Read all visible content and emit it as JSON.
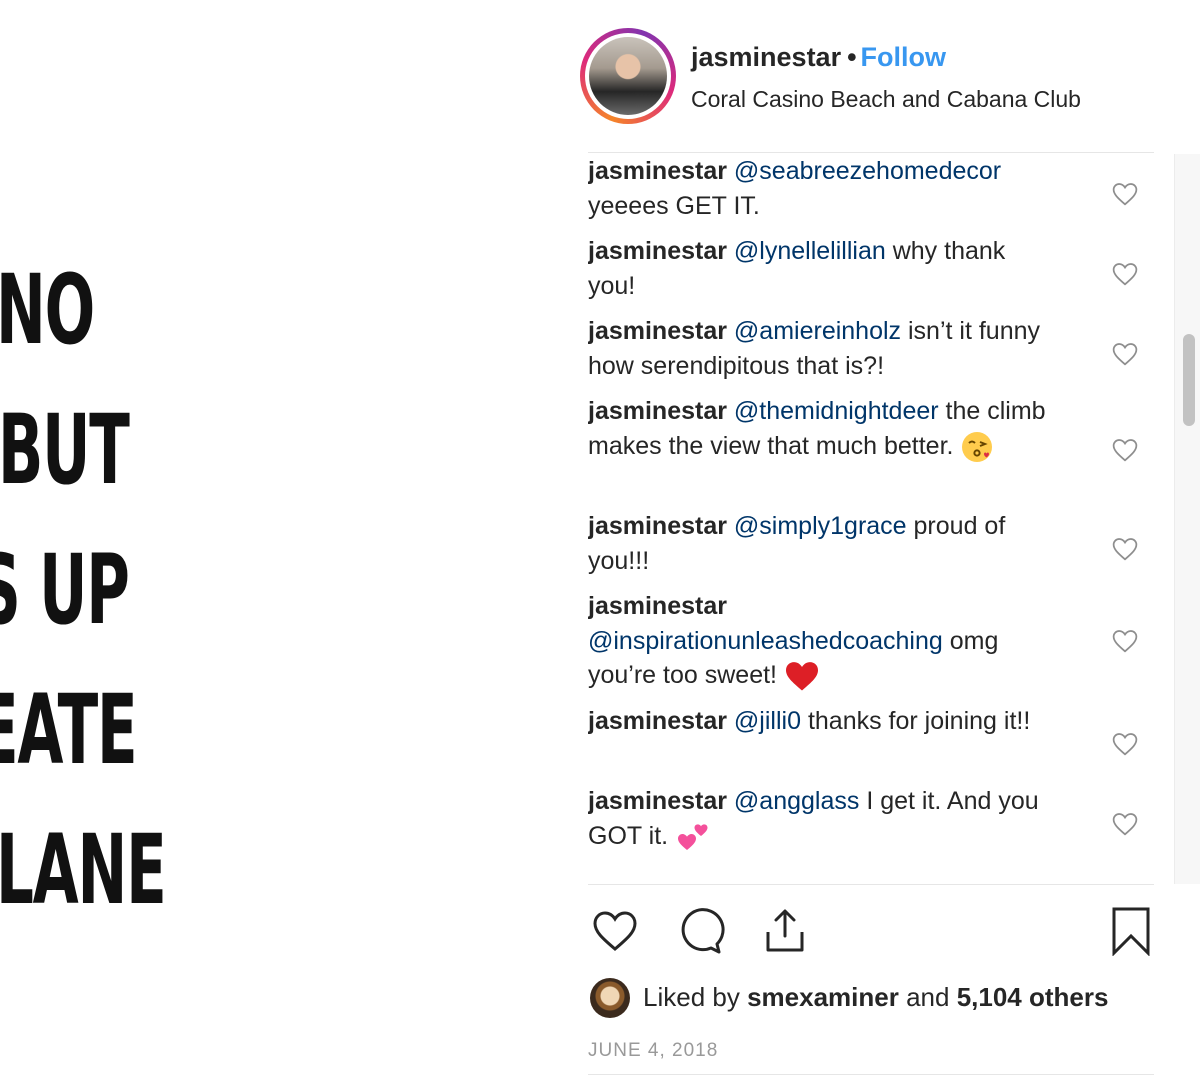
{
  "post_image": {
    "lines": [
      "NO",
      "BUT",
      "S UP",
      "EATE",
      "LANE"
    ]
  },
  "header": {
    "username": "jasminestar",
    "separator": "•",
    "follow_label": "Follow",
    "location": "Coral Casino Beach and Cabana Club"
  },
  "comments": [
    {
      "user": "jasminestar",
      "mention": "@seabreezehomedecor",
      "text": "yeeees GET IT.",
      "emoji": ""
    },
    {
      "user": "jasminestar",
      "mention": "@lynellelillian",
      "text": "why thank you!",
      "emoji": ""
    },
    {
      "user": "jasminestar",
      "mention": "@amiereinholz",
      "text": "isn’t it funny how serendipitous that is?!",
      "emoji": ""
    },
    {
      "user": "jasminestar",
      "mention": "@themidnightdeer",
      "text": "the climb makes the view that much better.",
      "emoji": "kiss-emoji"
    },
    {
      "user": "jasminestar",
      "mention": "@simply1grace",
      "text": "proud of you!!!",
      "emoji": ""
    },
    {
      "user": "jasminestar",
      "mention": "@inspirationunleashedcoaching",
      "text": "omg you’re too sweet!",
      "emoji": "red-heart-emoji"
    },
    {
      "user": "jasminestar",
      "mention": "@jilli0",
      "text": "thanks for joining it!!",
      "emoji": ""
    },
    {
      "user": "jasminestar",
      "mention": "@angglass",
      "text": "I get it. And you GOT it.",
      "emoji": "two-hearts-emoji"
    }
  ],
  "likes": {
    "prefix": "Liked by",
    "user": "smexaminer",
    "and": "and",
    "count": "5,104 others"
  },
  "date": "JUNE 4, 2018",
  "colors": {
    "follow": "#3897f0",
    "mention": "#003569",
    "text": "#262626",
    "date": "#999999"
  }
}
